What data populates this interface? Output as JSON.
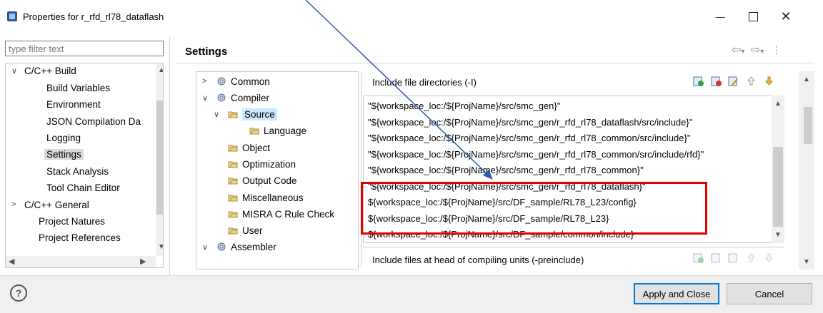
{
  "window": {
    "title": "Properties for r_rfd_rl78_dataflash"
  },
  "filter": {
    "placeholder": "type filter text"
  },
  "page": {
    "title": "Settings"
  },
  "left_tree": [
    {
      "label": "C/C++ Build",
      "twisty": "expanded"
    },
    {
      "label": "Build Variables"
    },
    {
      "label": "Environment"
    },
    {
      "label": "JSON Compilation Da"
    },
    {
      "label": "Logging"
    },
    {
      "label": "Settings",
      "selected": true
    },
    {
      "label": "Stack Analysis"
    },
    {
      "label": "Tool Chain Editor"
    },
    {
      "label": "C/C++ General",
      "twisty": "collapsed"
    },
    {
      "label": "Project Natures"
    },
    {
      "label": "Project References"
    }
  ],
  "tool_tree": [
    {
      "label": "Common",
      "twisty": "collapsed",
      "icon": "gear"
    },
    {
      "label": "Compiler",
      "twisty": "expanded",
      "icon": "gear"
    },
    {
      "label": "Source",
      "twisty": "expanded",
      "icon": "folder",
      "selected": true
    },
    {
      "label": "Language",
      "icon": "folder"
    },
    {
      "label": "Object",
      "icon": "folder"
    },
    {
      "label": "Optimization",
      "icon": "folder"
    },
    {
      "label": "Output Code",
      "icon": "folder"
    },
    {
      "label": "Miscellaneous",
      "icon": "folder"
    },
    {
      "label": "MISRA C Rule Check",
      "icon": "folder"
    },
    {
      "label": "User",
      "icon": "folder"
    },
    {
      "label": "Assembler",
      "twisty": "expanded",
      "icon": "gear"
    }
  ],
  "include_section": {
    "label": "Include file directories (-I)",
    "paths": [
      "\"${workspace_loc:/${ProjName}/src/smc_gen}\"",
      "\"${workspace_loc:/${ProjName}/src/smc_gen/r_rfd_rl78_dataflash/src/include}\"",
      "\"${workspace_loc:/${ProjName}/src/smc_gen/r_rfd_rl78_common/src/include}\"",
      "\"${workspace_loc:/${ProjName}/src/smc_gen/r_rfd_rl78_common/src/include/rfd}\"",
      "\"${workspace_loc:/${ProjName}/src/smc_gen/r_rfd_rl78_common}\"",
      "\"${workspace_loc:/${ProjName}/src/smc_gen/r_rfd_rl78_dataflash}\"",
      "${workspace_loc:/${ProjName}/src/DF_sample/RL78_L23/config}",
      "${workspace_loc:/${ProjName}/src/DF_sample/RL78_L23}",
      "${workspace_loc:/${ProjName}/src/DF_sample/common/include}"
    ]
  },
  "preinclude_section": {
    "label": "Include files at head of compiling units (-preinclude)"
  },
  "buttons": {
    "apply": "Apply and Close",
    "cancel": "Cancel"
  },
  "colors": {
    "highlight_box": "#e00000",
    "selection": "#cce8ff",
    "arrow": "#2f5da9",
    "accent": "#0078d7"
  }
}
